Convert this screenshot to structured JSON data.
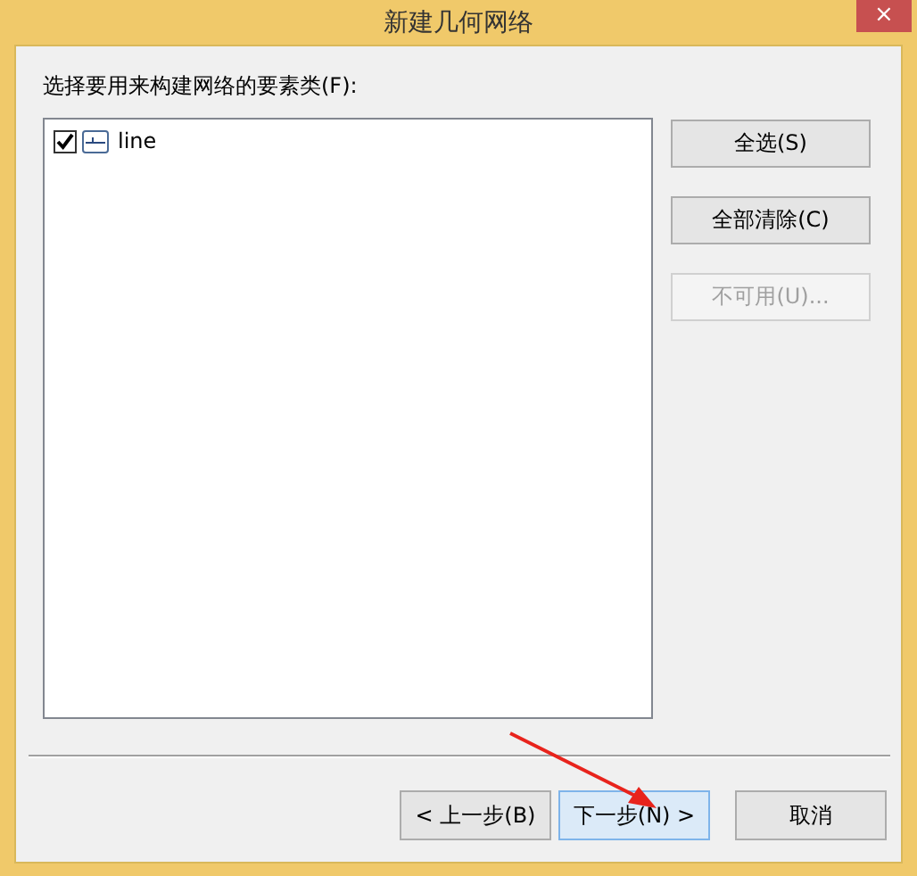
{
  "window": {
    "title": "新建几何网络",
    "close": "×"
  },
  "prompt": "选择要用来构建网络的要素类(F):",
  "feature_classes": [
    {
      "name": "line",
      "checked": true
    }
  ],
  "side_buttons": [
    {
      "label": "全选(S)",
      "disabled": false
    },
    {
      "label": "全部清除(C)",
      "disabled": false
    },
    {
      "label": "不可用(U)...",
      "disabled": true
    }
  ],
  "footer_buttons": [
    {
      "label": "< 上一步(B)",
      "selected": false
    },
    {
      "label": "下一步(N) >",
      "selected": true
    },
    {
      "label": "取消",
      "selected": false
    }
  ]
}
